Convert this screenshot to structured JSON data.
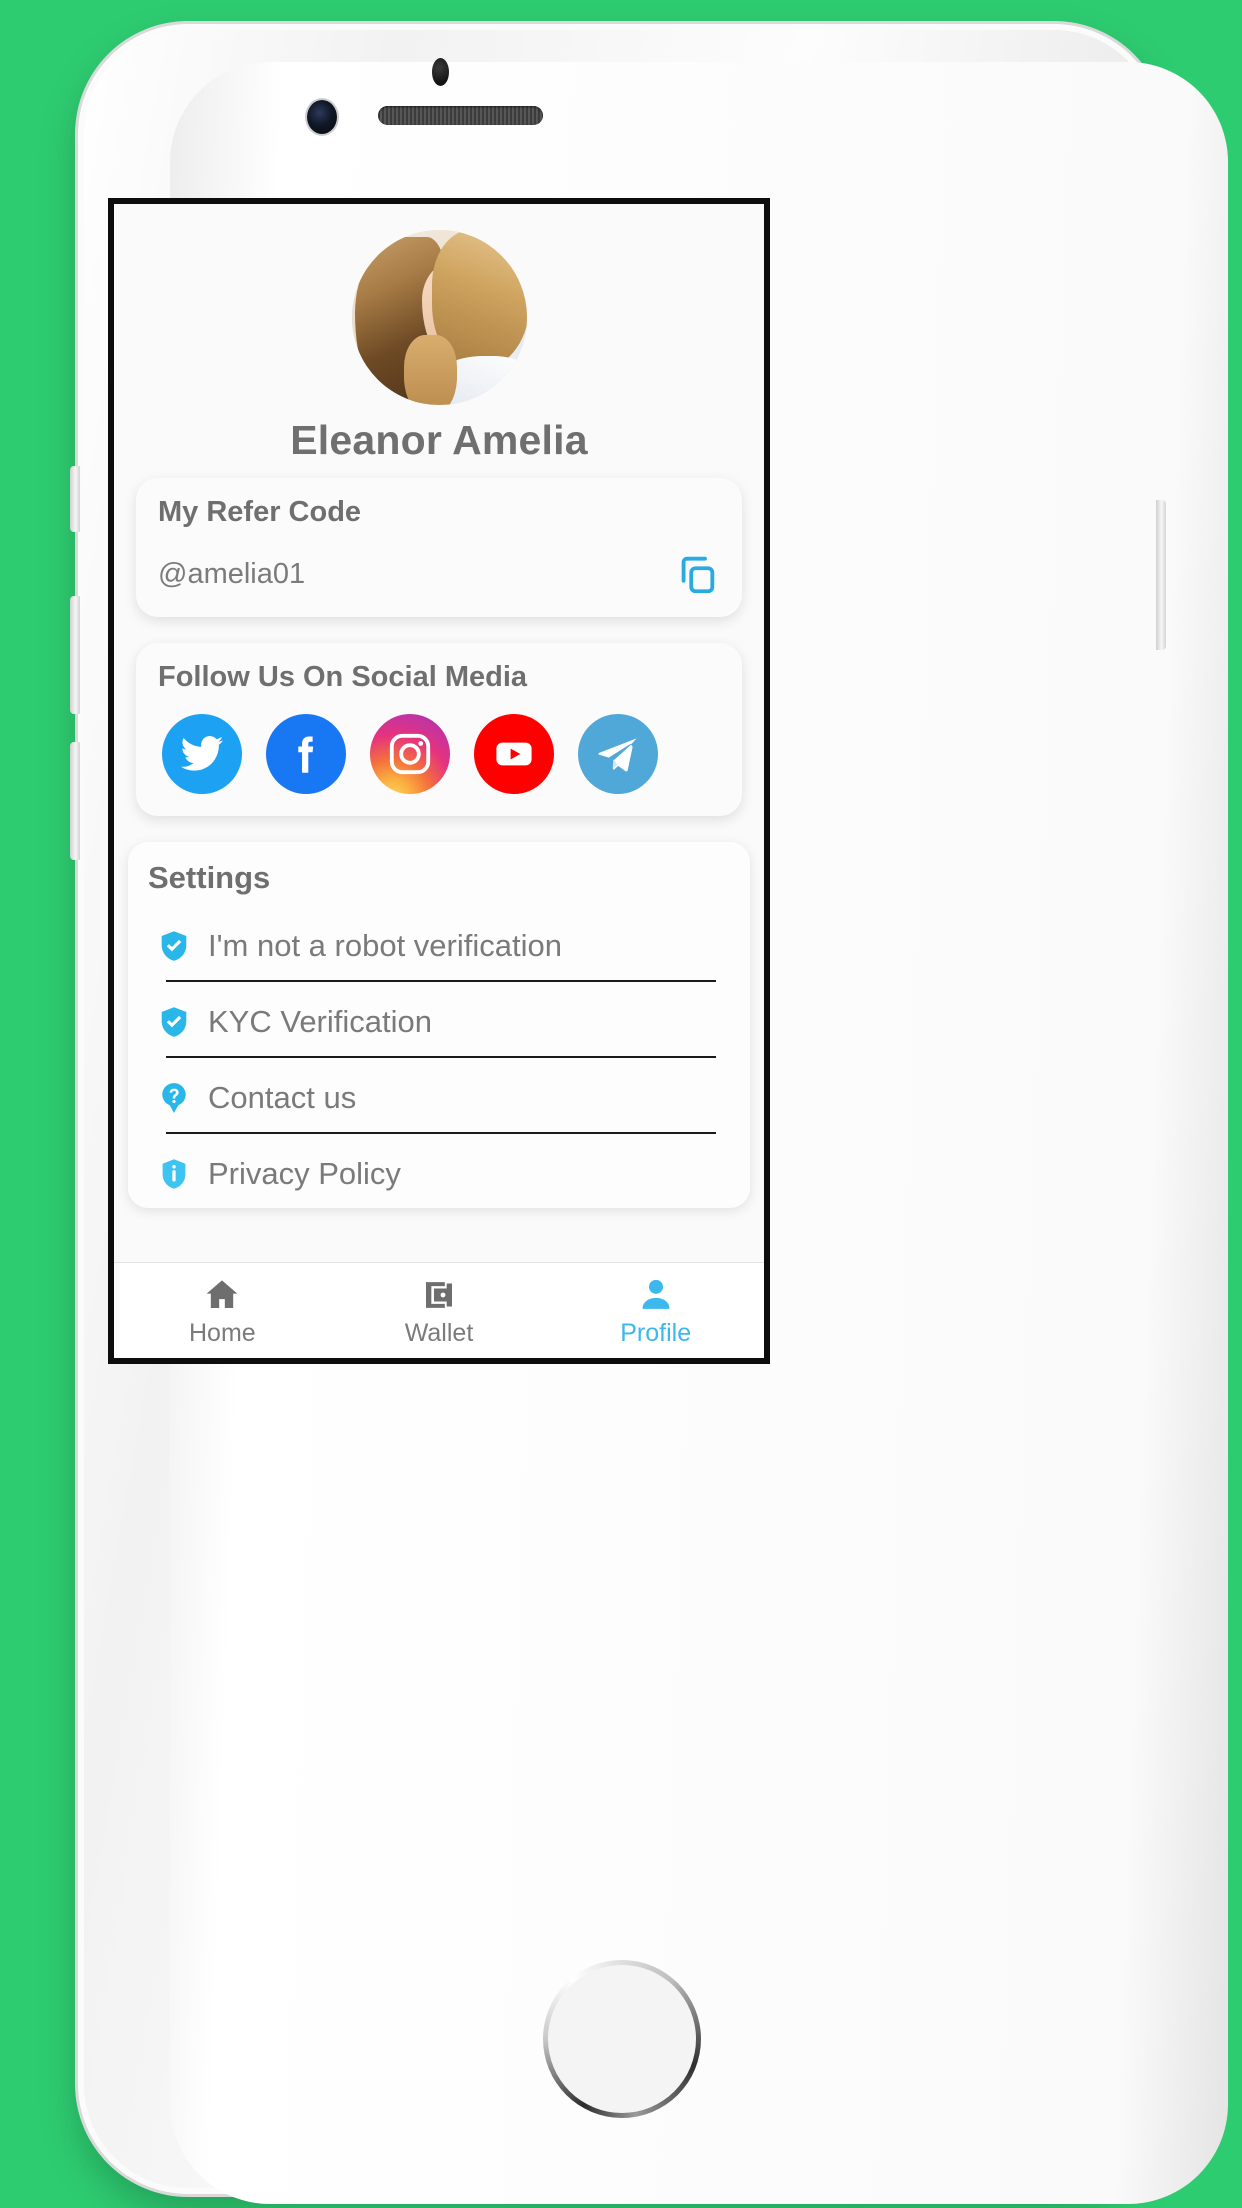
{
  "theme": {
    "background": "#2ECC71",
    "accent": "#29ABE2",
    "nav_active": "#3CB8EC",
    "text_gray": "#6F6F6F",
    "card_bg": "#FBFBFB",
    "screen_bg": "#FAFAFA",
    "divider": "#1B1B1B"
  },
  "device": {
    "name": "iphone-mockup",
    "body_color": "#FFFFFF",
    "sensor_icon": "proximity-sensor",
    "camera_icon": "front-camera",
    "speaker_icon": "earpiece-speaker",
    "home_button_icon": "home-button"
  },
  "profile": {
    "avatar_icon": "user-avatar-photo",
    "name": "Eleanor Amelia"
  },
  "refer": {
    "title": "My Refer Code",
    "code": "@amelia01",
    "copy_icon": "copy-icon",
    "copy_color": "#29ABE2"
  },
  "social": {
    "title": "Follow Us On Social Media",
    "items": [
      {
        "name": "twitter",
        "icon": "twitter-icon",
        "color": "#1DA1F2"
      },
      {
        "name": "facebook",
        "icon": "facebook-icon",
        "color": "#1877F2"
      },
      {
        "name": "instagram",
        "icon": "instagram-icon",
        "color": "#E5327F"
      },
      {
        "name": "youtube",
        "icon": "youtube-icon",
        "color": "#FF0000"
      },
      {
        "name": "telegram",
        "icon": "telegram-icon",
        "color": "#4FA8D8"
      }
    ]
  },
  "settings": {
    "title": "Settings",
    "items": [
      {
        "label": "I'm not a robot verification",
        "icon": "shield-check-icon",
        "color": "#29B6E8"
      },
      {
        "label": "KYC Verification",
        "icon": "shield-check-icon",
        "color": "#29B6E8"
      },
      {
        "label": "Contact us",
        "icon": "help-question-icon",
        "color": "#29B6E8"
      },
      {
        "label": "Privacy Policy",
        "icon": "shield-info-icon",
        "color": "#29B6E8"
      }
    ]
  },
  "bottom_nav": {
    "items": [
      {
        "label": "Home",
        "icon": "home-icon",
        "active": false
      },
      {
        "label": "Wallet",
        "icon": "wallet-icon",
        "active": false
      },
      {
        "label": "Profile",
        "icon": "person-icon",
        "active": true
      }
    ]
  }
}
